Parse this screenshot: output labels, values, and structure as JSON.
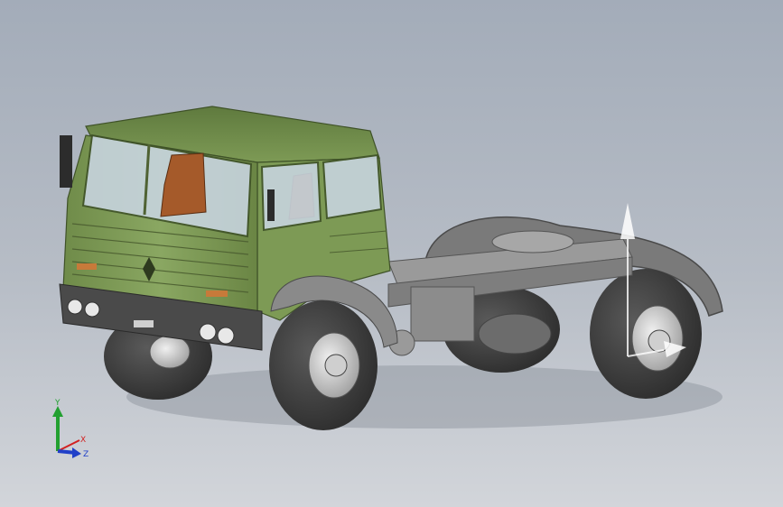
{
  "viewport": {
    "background_top": "#a3acb9",
    "background_bottom": "#d2d5da"
  },
  "model": {
    "cab_color": "#7d9a55",
    "chassis_color": "#8f8f8f",
    "tire_color": "#3a3a3a",
    "glass_color": "#c7d4de",
    "seat_color": "#a55a2a"
  },
  "triad": {
    "x_label": "X",
    "y_label": "Y",
    "z_label": "Z",
    "x_color": "#d22020",
    "y_color": "#22a030",
    "z_color": "#2040c8",
    "icons": [
      "view-triad-icon"
    ]
  }
}
